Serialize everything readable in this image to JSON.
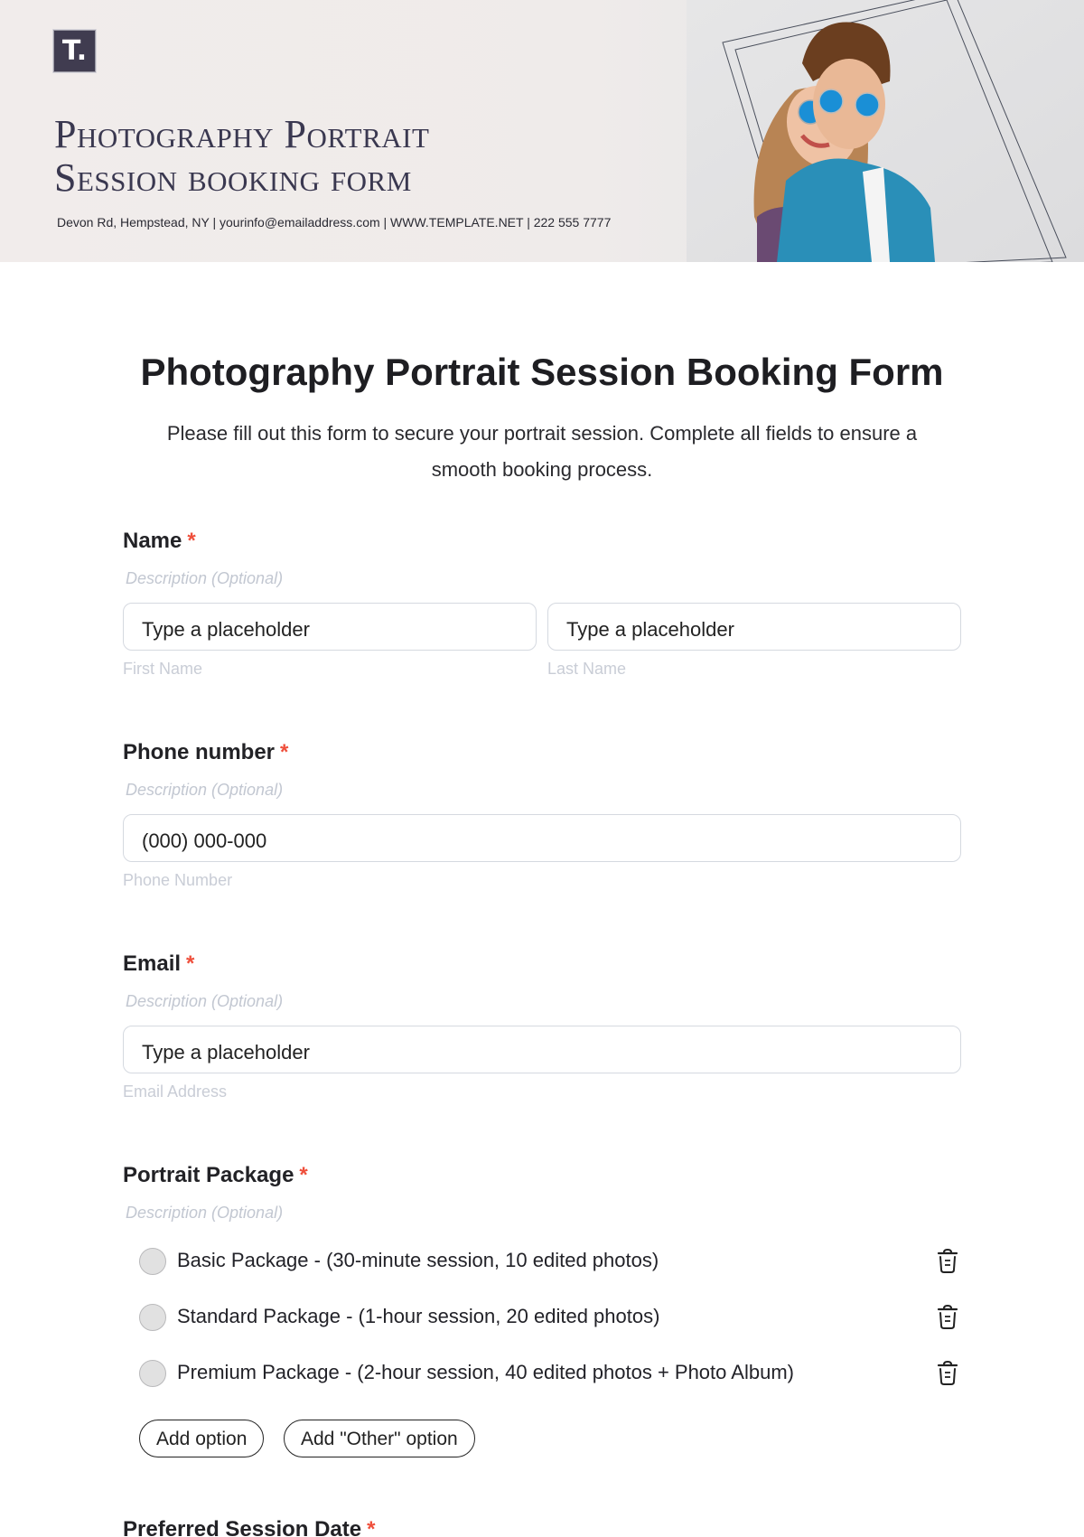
{
  "banner": {
    "logo_letter": "T.",
    "title_line1": "Photography Portrait",
    "title_line2": "Session booking form",
    "contact": "Devon Rd, Hempstead, NY | yourinfo@emailaddress.com | WWW.TEMPLATE.NET | 222 555 7777"
  },
  "form": {
    "title": "Photography Portrait Session Booking Form",
    "subtitle_line1": "Please fill out this form to secure your portrait session. Complete all fields to ensure a",
    "subtitle_line2": "smooth booking process."
  },
  "fields": {
    "name": {
      "label": "Name",
      "required": "*",
      "description": "Description (Optional)",
      "first_placeholder": "Type a placeholder",
      "last_placeholder": "Type a placeholder",
      "first_sublabel": "First Name",
      "last_sublabel": "Last Name"
    },
    "phone": {
      "label": "Phone number",
      "required": "*",
      "description": "Description (Optional)",
      "placeholder": "(000) 000-000",
      "sublabel": "Phone Number"
    },
    "email": {
      "label": "Email",
      "required": "*",
      "description": "Description (Optional)",
      "placeholder": "Type a placeholder",
      "sublabel": "Email Address"
    },
    "package": {
      "label": "Portrait Package",
      "required": "*",
      "description": "Description (Optional)",
      "options": [
        {
          "label": "Basic Package - (30-minute session, 10 edited photos)"
        },
        {
          "label": "Standard Package - (1-hour session, 20 edited photos)"
        },
        {
          "label": "Premium Package - (2-hour session, 40 edited photos + Photo Album)"
        }
      ],
      "add_option": "Add option",
      "add_other_option": "Add \"Other\" option"
    },
    "session_date": {
      "label": "Preferred Session Date",
      "required": "*"
    }
  },
  "colors": {
    "required": "#ef4f3b",
    "logo_bg": "#403c50",
    "input_border": "#d5d9e0"
  }
}
